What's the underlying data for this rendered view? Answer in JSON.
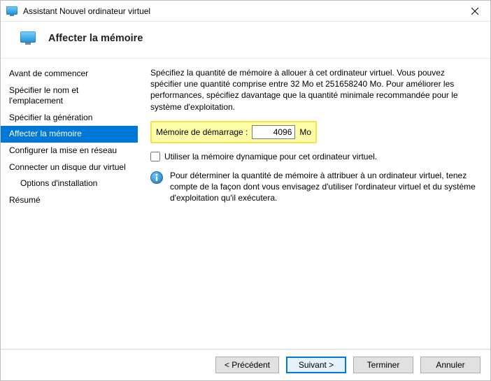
{
  "window": {
    "title": "Assistant Nouvel ordinateur virtuel"
  },
  "header": {
    "page_title": "Affecter la mémoire"
  },
  "nav": {
    "items": [
      {
        "label": "Avant de commencer",
        "selected": false,
        "indent": false
      },
      {
        "label": "Spécifier le nom et l'emplacement",
        "selected": false,
        "indent": false
      },
      {
        "label": "Spécifier la génération",
        "selected": false,
        "indent": false
      },
      {
        "label": "Affecter la mémoire",
        "selected": true,
        "indent": false
      },
      {
        "label": "Configurer la mise en réseau",
        "selected": false,
        "indent": false
      },
      {
        "label": "Connecter un disque dur virtuel",
        "selected": false,
        "indent": false
      },
      {
        "label": "Options d'installation",
        "selected": false,
        "indent": true
      },
      {
        "label": "Résumé",
        "selected": false,
        "indent": false
      }
    ]
  },
  "content": {
    "description": "Spécifiez la quantité de mémoire à allouer à cet ordinateur virtuel. Vous pouvez spécifier une quantité comprise entre 32 Mo et 251658240 Mo. Pour améliorer les performances, spécifiez davantage que la quantité minimale recommandée pour le système d'exploitation.",
    "memory_label": "Mémoire de démarrage :",
    "memory_value": "4096",
    "memory_unit": "Mo",
    "dynamic_checkbox_label": "Utiliser la mémoire dynamique pour cet ordinateur virtuel.",
    "dynamic_checked": false,
    "info_text": "Pour déterminer la quantité de mémoire à attribuer à un ordinateur virtuel, tenez compte de la façon dont vous envisagez d'utiliser l'ordinateur virtuel et du système d'exploitation qu'il exécutera."
  },
  "buttons": {
    "previous": "< Précédent",
    "next": "Suivant >",
    "finish": "Terminer",
    "cancel": "Annuler"
  }
}
